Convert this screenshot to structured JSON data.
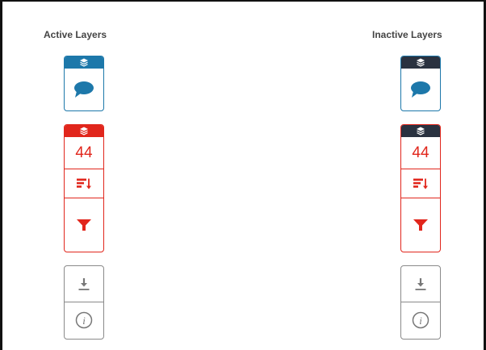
{
  "headings": {
    "active": "Active Layers",
    "inactive": "Inactive Layers"
  },
  "colors": {
    "active_header": "#1d78aa",
    "active_red_header": "#e1261c",
    "inactive_header": "#2a3240",
    "blue": "#1d78aa",
    "red": "#e1261c",
    "gray": "#8a8a8a"
  },
  "active": {
    "comments_group": {
      "icons": [
        "layers-icon",
        "comment-icon"
      ]
    },
    "count_group": {
      "count": "44",
      "icons": [
        "layers-icon",
        "sort-icon",
        "filter-icon"
      ]
    },
    "tools_group": {
      "icons": [
        "download-icon",
        "info-icon"
      ]
    }
  },
  "inactive": {
    "comments_group": {
      "icons": [
        "layers-icon",
        "comment-icon"
      ]
    },
    "count_group": {
      "count": "44",
      "icons": [
        "layers-icon",
        "sort-icon",
        "filter-icon"
      ]
    },
    "tools_group": {
      "icons": [
        "download-icon",
        "info-icon"
      ]
    }
  }
}
